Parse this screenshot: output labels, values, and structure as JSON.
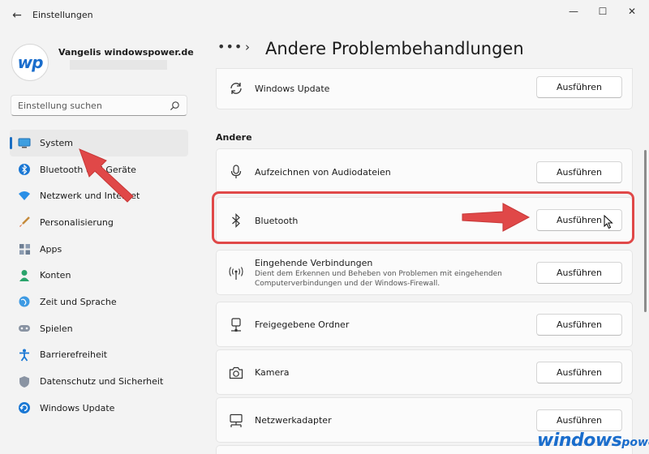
{
  "window": {
    "title": "Einstellungen",
    "back_glyph": "←",
    "minimize_glyph": "—",
    "maximize_glyph": "☐",
    "close_glyph": "✕"
  },
  "profile": {
    "avatar_text": "wp",
    "name": "Vangelis windowspower.de"
  },
  "search": {
    "placeholder": "Einstellung suchen",
    "icon": "search-icon"
  },
  "sidebar": {
    "items": [
      {
        "label": "System",
        "icon": "monitor-icon",
        "active": true
      },
      {
        "label": "Bluetooth und Geräte",
        "icon": "bluetooth-icon"
      },
      {
        "label": "Netzwerk und Internet",
        "icon": "wifi-icon"
      },
      {
        "label": "Personalisierung",
        "icon": "brush-icon"
      },
      {
        "label": "Apps",
        "icon": "apps-icon"
      },
      {
        "label": "Konten",
        "icon": "person-icon"
      },
      {
        "label": "Zeit und Sprache",
        "icon": "globe-icon"
      },
      {
        "label": "Spielen",
        "icon": "gamepad-icon"
      },
      {
        "label": "Barrierefreiheit",
        "icon": "accessibility-icon"
      },
      {
        "label": "Datenschutz und Sicherheit",
        "icon": "shield-icon"
      },
      {
        "label": "Windows Update",
        "icon": "update-icon"
      }
    ]
  },
  "main": {
    "breadcrumb_dots": "•••",
    "breadcrumb_sep": "›",
    "title": "Andere Problembehandlungen",
    "section_label": "Andere",
    "run_label": "Ausführen",
    "cards": [
      {
        "title": "Windows Update",
        "icon": "refresh-icon"
      },
      {
        "title": "Aufzeichnen von Audiodateien",
        "icon": "microphone-icon"
      },
      {
        "title": "Bluetooth",
        "icon": "bluetooth-icon",
        "highlighted": true
      },
      {
        "title": "Eingehende Verbindungen",
        "icon": "antenna-icon",
        "description": "Dient dem Erkennen und Beheben von Problemen mit eingehenden Computerverbindungen und der Windows-Firewall."
      },
      {
        "title": "Freigegebene Ordner",
        "icon": "shared-folder-icon"
      },
      {
        "title": "Kamera",
        "icon": "camera-icon"
      },
      {
        "title": "Netzwerkadapter",
        "icon": "network-adapter-icon"
      }
    ]
  },
  "watermark": {
    "part1": "windows",
    "part2": "power"
  },
  "colors": {
    "accent": "#1b6ec2",
    "highlight": "#e04848",
    "arrow": "#e04848"
  }
}
